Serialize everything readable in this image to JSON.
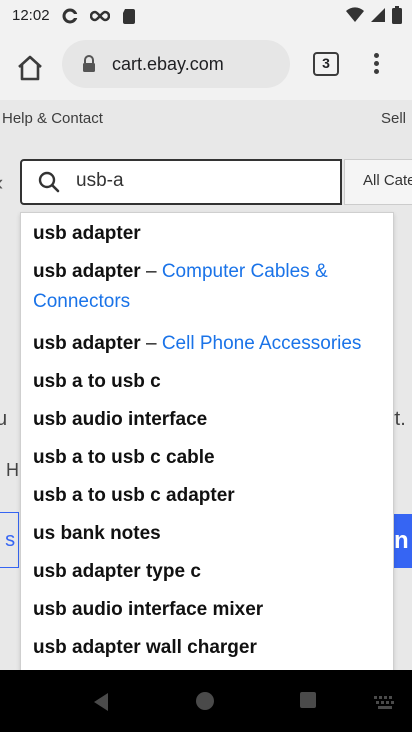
{
  "status_bar": {
    "time": "12:02"
  },
  "browser": {
    "url": "cart.ebay.com",
    "tab_count": "3"
  },
  "page": {
    "help_link": "Help & Contact",
    "sell_link": "Sell",
    "search_value": "usb-a",
    "category_label": "All Cate",
    "fragments": {
      "f1": "u",
      "f2": "rt.",
      "f3": "H",
      "f4": "t s",
      "f5": "n"
    }
  },
  "suggestions": [
    {
      "text": "usb adapter",
      "dash": "",
      "category": ""
    },
    {
      "text": "usb adapter",
      "dash": " – ",
      "category": "Computer Cables &",
      "category_line2": "Connectors"
    },
    {
      "text": "usb adapter",
      "dash": " – ",
      "category": "Cell Phone Accessories"
    },
    {
      "text": "usb a to usb c",
      "dash": "",
      "category": ""
    },
    {
      "text": "usb audio interface",
      "dash": "",
      "category": ""
    },
    {
      "text": "usb a to usb c cable",
      "dash": "",
      "category": ""
    },
    {
      "text": "usb a to usb c adapter",
      "dash": "",
      "category": ""
    },
    {
      "text": "us bank notes",
      "dash": "",
      "category": ""
    },
    {
      "text": "usb adapter type c",
      "dash": "",
      "category": ""
    },
    {
      "text": "usb audio interface mixer",
      "dash": "",
      "category": ""
    },
    {
      "text": "usb adapter wall charger",
      "dash": "",
      "category": ""
    }
  ],
  "colors": {
    "link_blue": "#1a73e8",
    "ebay_blue": "#3665f3"
  }
}
